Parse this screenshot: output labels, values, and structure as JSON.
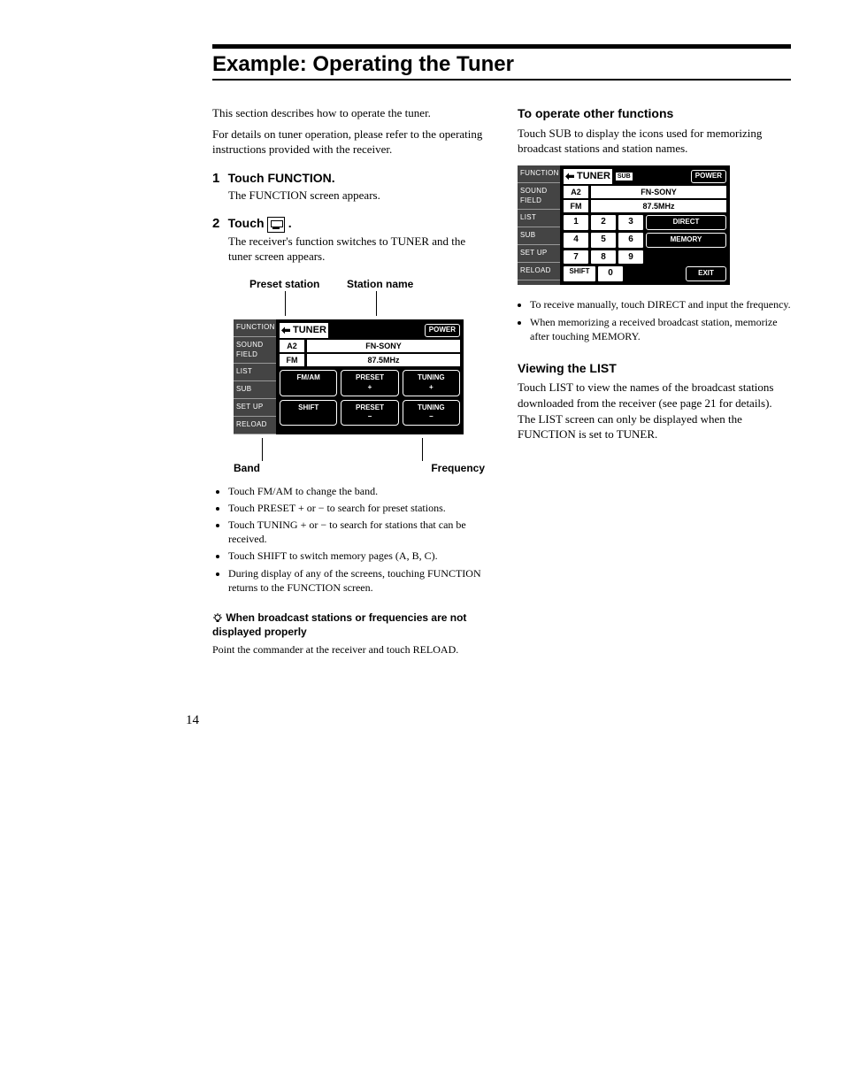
{
  "title": "Example: Operating the Tuner",
  "left": {
    "intro1": "This section describes how to operate the tuner.",
    "intro2": "For details on tuner operation, please refer to the operating instructions provided with the receiver.",
    "step1_num": "1",
    "step1_head": "Touch FUNCTION.",
    "step1_body": "The FUNCTION screen appears.",
    "step2_num": "2",
    "step2_head_a": "Touch ",
    "step2_head_b": ".",
    "step2_body": "The receiver's function switches to TUNER and the tuner screen appears.",
    "lab_preset": "Preset station",
    "lab_station": "Station name",
    "lab_band": "Band",
    "lab_freq": "Frequency",
    "side": {
      "r0": "FUNCTION",
      "r1": "SOUND\nFIELD",
      "r2": "LIST",
      "r3": "SUB",
      "r4": "SET UP",
      "r5": "RELOAD"
    },
    "screen1": {
      "tuner": "TUNER",
      "power": "POWER",
      "cell_a2": "A2",
      "cell_fnsony": "FN-SONY",
      "cell_fm": "FM",
      "cell_freq": "87.5MHz",
      "btn_fmam": "FM/AM",
      "btn_presetp": "PRESET\n+",
      "btn_tuningp": "TUNING\n+",
      "btn_shift": "SHIFT",
      "btn_presetm": "PRESET\n−",
      "btn_tuningm": "TUNING\n−"
    },
    "bullets": [
      "Touch FM/AM to change the band.",
      "Touch PRESET + or − to search for preset stations.",
      "Touch TUNING + or − to search for stations that can be received.",
      "Touch SHIFT to switch memory pages (A, B, C).",
      "During display of any of the screens, touching FUNCTION returns to the FUNCTION screen."
    ],
    "tip_head": "When broadcast stations or frequencies are not displayed properly",
    "tip_body": "Point the commander at the receiver and touch RELOAD."
  },
  "right": {
    "head1": "To operate other functions",
    "p1": "Touch SUB to display the icons used for memorizing broadcast stations and station names.",
    "screen2": {
      "tuner": "TUNER",
      "sub": "SUB",
      "power": "POWER",
      "cell_a2": "A2",
      "cell_fnsony": "FN-SONY",
      "cell_fm": "FM",
      "cell_freq": "87.5MHz",
      "k1": "1",
      "k2": "2",
      "k3": "3",
      "direct": "DIRECT",
      "k4": "4",
      "k5": "5",
      "k6": "6",
      "memory": "MEMORY",
      "k7": "7",
      "k8": "8",
      "k9": "9",
      "shift": "SHIFT",
      "k0": "0",
      "exit": "EXIT"
    },
    "bullets2": [
      "To receive manually, touch DIRECT and input the frequency.",
      "When memorizing a received broadcast station, memorize after touching MEMORY."
    ],
    "head2": "Viewing the LIST",
    "p2": "Touch LIST to view the names of the broadcast stations downloaded from the receiver (see page 21 for details). The LIST screen can only be displayed when the FUNCTION is set to TUNER."
  },
  "page_number": "14"
}
